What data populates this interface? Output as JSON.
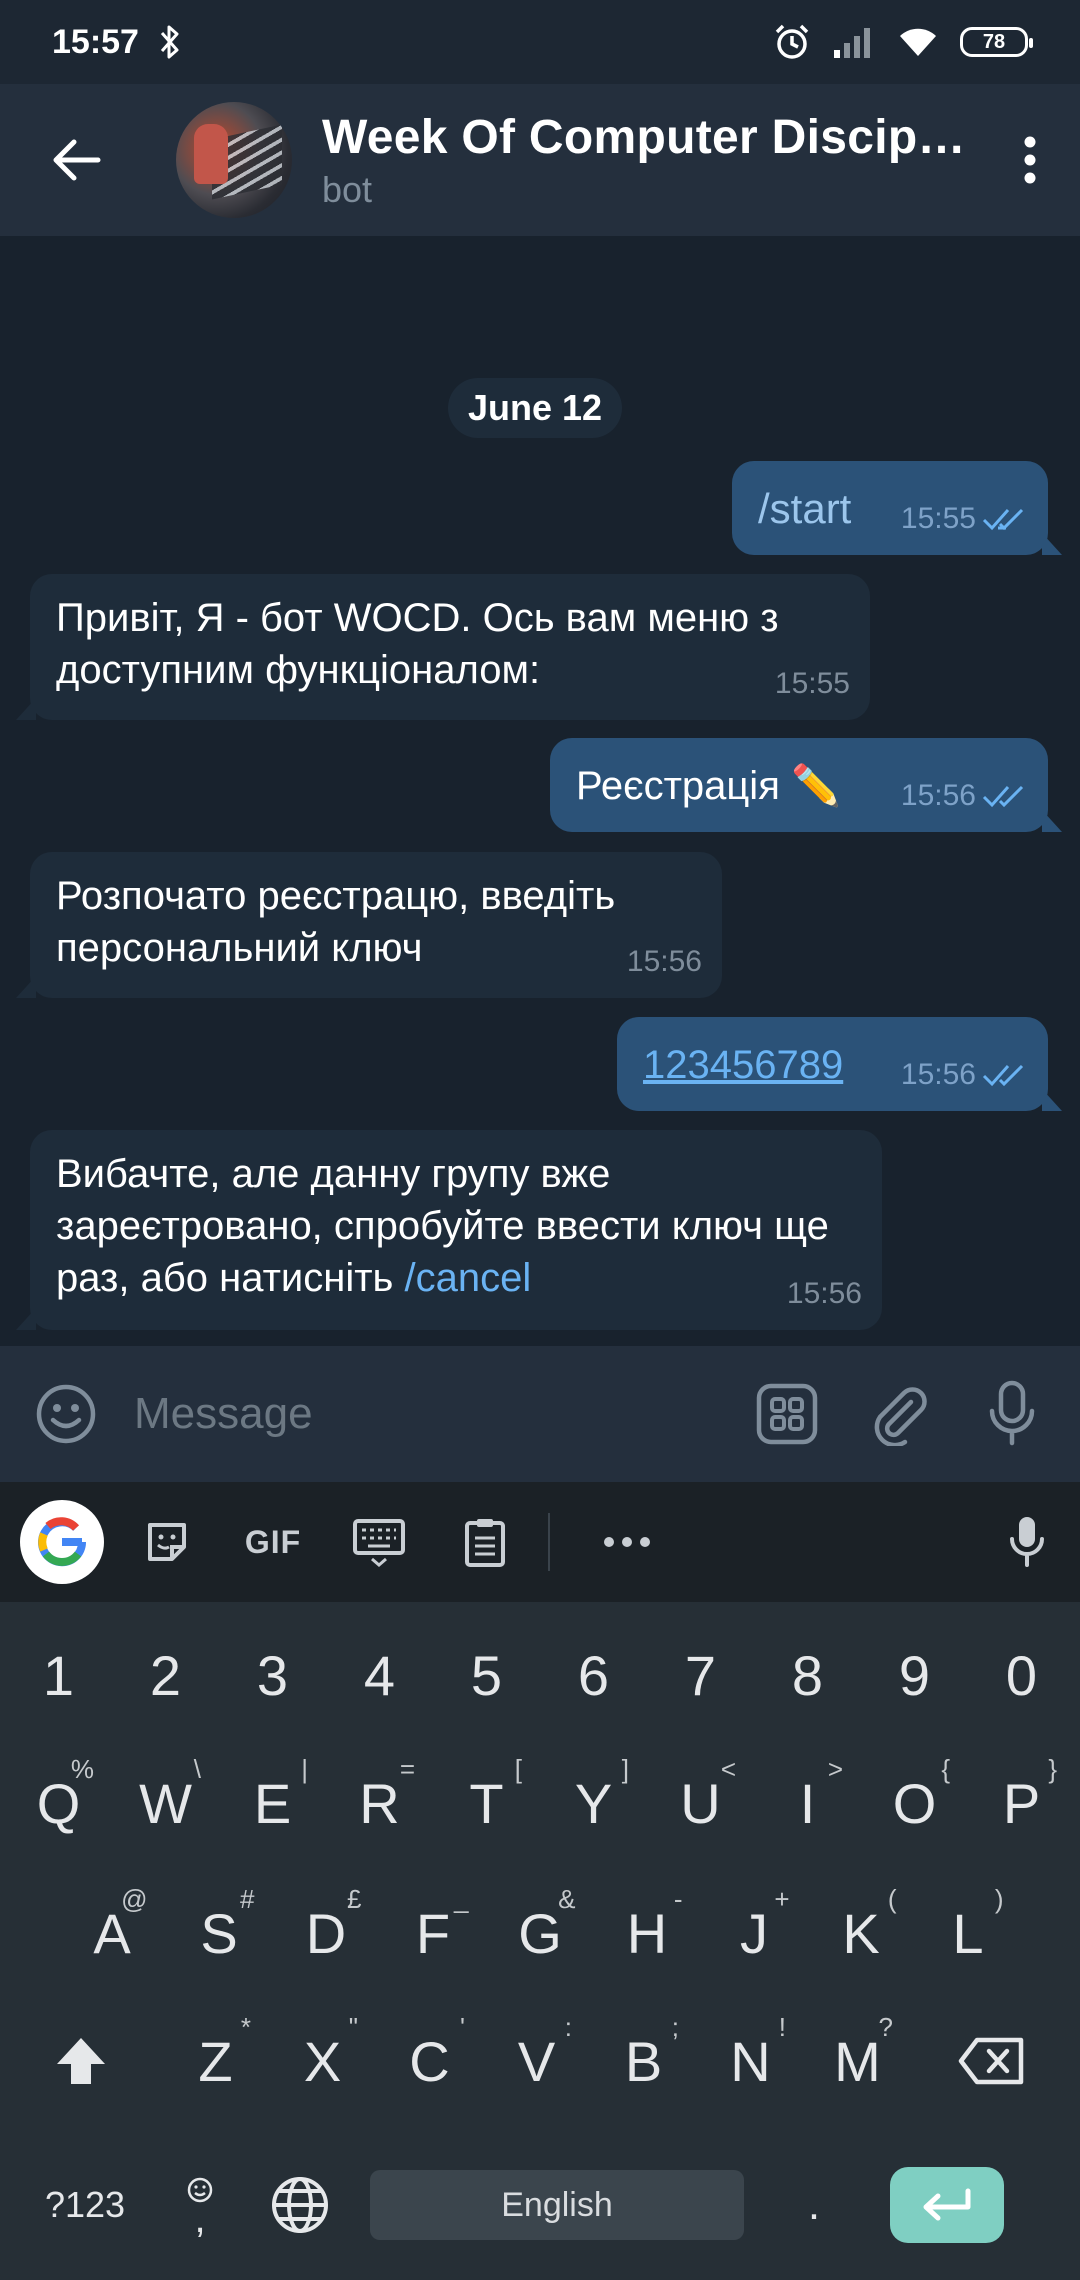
{
  "status_bar": {
    "time": "15:57",
    "battery": "78"
  },
  "header": {
    "title": "Week Of Computer Discipl…",
    "subtitle": "bot"
  },
  "chat": {
    "date_separator": "June 12",
    "messages": [
      {
        "dir": "out",
        "text": "/start",
        "time": "15:55"
      },
      {
        "dir": "in",
        "text": "Привіт, Я - бот WOCD. Ось вам меню з доступним функціоналом:",
        "time": "15:55"
      },
      {
        "dir": "out",
        "text": "Реєстрація ✏️",
        "time": "15:56"
      },
      {
        "dir": "in",
        "text": "Розпочато реєстрацю, введіть персональний ключ",
        "time": "15:56"
      },
      {
        "dir": "out",
        "text": "123456789",
        "time": "15:56"
      },
      {
        "dir": "in",
        "text": "Вибачте, але данну групу вже зареєтровано, спробуйте ввести ключ ще раз, або натисніть",
        "link": "/cancel",
        "time": "15:56"
      }
    ]
  },
  "composer": {
    "placeholder": "Message"
  },
  "keyboard": {
    "toolbar_gif": "GIF",
    "numbers": [
      "1",
      "2",
      "3",
      "4",
      "5",
      "6",
      "7",
      "8",
      "9",
      "0"
    ],
    "row1": [
      {
        "k": "Q",
        "h": "%"
      },
      {
        "k": "W",
        "h": "\\"
      },
      {
        "k": "E",
        "h": "|"
      },
      {
        "k": "R",
        "h": "="
      },
      {
        "k": "T",
        "h": "["
      },
      {
        "k": "Y",
        "h": "]"
      },
      {
        "k": "U",
        "h": "<"
      },
      {
        "k": "I",
        "h": ">"
      },
      {
        "k": "O",
        "h": "{"
      },
      {
        "k": "P",
        "h": "}"
      }
    ],
    "row2": [
      {
        "k": "A",
        "h": "@"
      },
      {
        "k": "S",
        "h": "#"
      },
      {
        "k": "D",
        "h": "£"
      },
      {
        "k": "F",
        "h": "_"
      },
      {
        "k": "G",
        "h": "&"
      },
      {
        "k": "H",
        "h": "-"
      },
      {
        "k": "J",
        "h": "+"
      },
      {
        "k": "K",
        "h": "("
      },
      {
        "k": "L",
        "h": ")"
      }
    ],
    "row3": [
      {
        "k": "Z",
        "h": "*"
      },
      {
        "k": "X",
        "h": "\""
      },
      {
        "k": "C",
        "h": "'"
      },
      {
        "k": "V",
        "h": ":"
      },
      {
        "k": "B",
        "h": ";"
      },
      {
        "k": "N",
        "h": "!"
      },
      {
        "k": "M",
        "h": "?"
      }
    ],
    "symbols_key": "?123",
    "comma_key": ",",
    "period_key": ".",
    "space_label": "English"
  },
  "colors": {
    "accent_link": "#6ab3f3",
    "outgoing_bubble": "#2b5278",
    "incoming_bubble": "#1e2c3a",
    "enter_key": "#7fcfc2"
  }
}
